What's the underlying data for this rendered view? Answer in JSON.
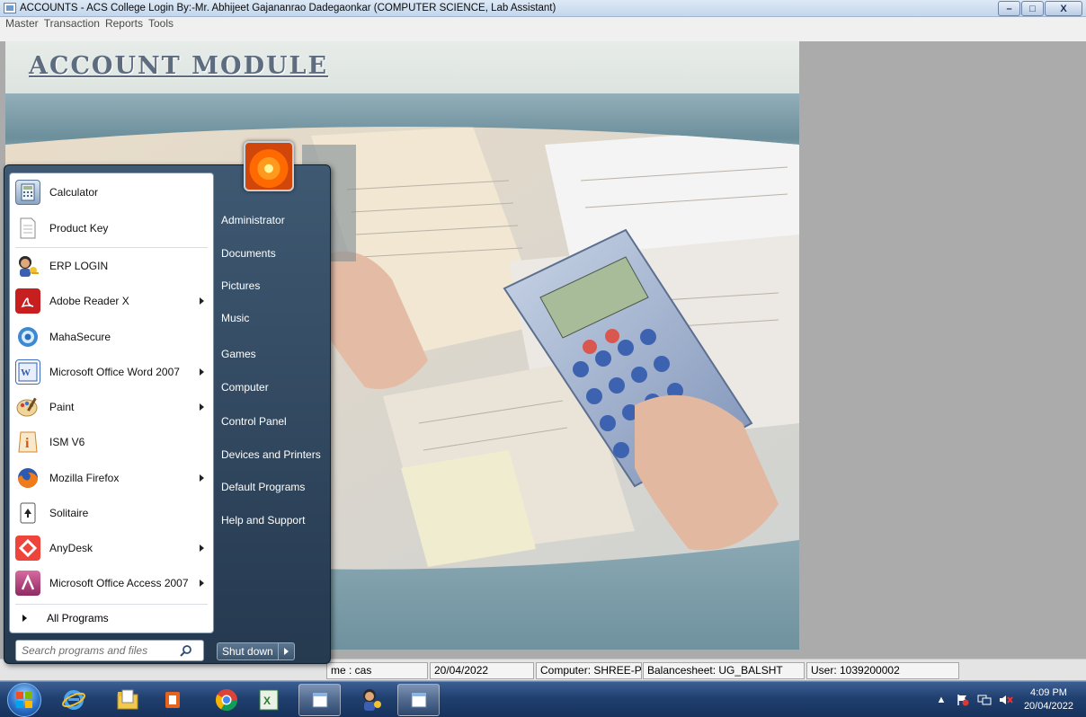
{
  "window": {
    "title": "ACCOUNTS - ACS College  Login By:-Mr. Abhijeet Gajananrao Dadegaonkar  (COMPUTER SCIENCE,  Lab Assistant)"
  },
  "menu": {
    "items": [
      "Master",
      "Transaction",
      "Reports",
      "Tools"
    ]
  },
  "module": {
    "title": "ACCOUNT MODULE"
  },
  "status": {
    "db_name": "me : cas",
    "date": "20/04/2022",
    "computer": "Computer: SHREE-PC",
    "balancesheet": "Balancesheet: UG_BALSHT",
    "user": "User: 1039200002"
  },
  "start_menu": {
    "programs": [
      {
        "label": "Calculator",
        "icon": "calculator-icon"
      },
      {
        "label": "Product Key",
        "icon": "document-icon"
      },
      {
        "label": "ERP LOGIN",
        "icon": "erp-login-icon"
      },
      {
        "label": "Adobe Reader X",
        "icon": "adobe-reader-icon"
      },
      {
        "label": "MahaSecure",
        "icon": "mahasecure-icon"
      },
      {
        "label": "Microsoft Office Word 2007",
        "icon": "word-icon"
      },
      {
        "label": "Paint",
        "icon": "paint-icon"
      },
      {
        "label": "ISM V6",
        "icon": "ism-icon"
      },
      {
        "label": "Mozilla Firefox",
        "icon": "firefox-icon"
      },
      {
        "label": "Solitaire",
        "icon": "solitaire-icon"
      },
      {
        "label": "AnyDesk",
        "icon": "anydesk-icon"
      },
      {
        "label": "Microsoft Office Access 2007",
        "icon": "access-icon"
      }
    ],
    "all_programs": "All Programs",
    "search_placeholder": "Search programs and files",
    "links": [
      "Administrator",
      "Documents",
      "Pictures",
      "Music",
      "Games",
      "Computer",
      "Control Panel",
      "Devices and Printers",
      "Default Programs",
      "Help and Support"
    ],
    "shutdown_label": "Shut down"
  },
  "taskbar": {
    "time": "4:09 PM",
    "date": "20/04/2022",
    "pinned": [
      "internet-explorer-icon",
      "file-explorer-icon",
      "office-icon",
      "chrome-icon",
      "excel-icon",
      "window-icon",
      "erp-login-icon",
      "window-icon"
    ]
  },
  "colors": {
    "taskbar": "#20406f",
    "start_menu": "#2f475f",
    "module_band": "#6c8f9c"
  }
}
